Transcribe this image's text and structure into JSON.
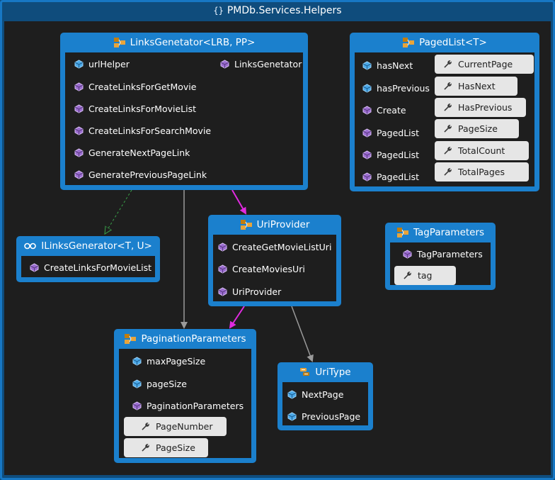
{
  "namespace": {
    "title": "PMDb.Services.Helpers",
    "icon": "namespace-icon"
  },
  "colors": {
    "frame": "#1777c4",
    "box": "#1b80cd",
    "canvas": "#1e1e1e",
    "association": "#e02ae0",
    "dependency": "#9a9a9a",
    "inheritance": "#3aa34a"
  },
  "links_generator": {
    "title": "LinksGenetator<LRB, PP>",
    "members": [
      "urlHelper",
      "CreateLinksForGetMovie",
      "CreateLinksForMovieList",
      "CreateLinksForSearchMovie",
      "GenerateNextPageLink",
      "GeneratePreviousPageLink"
    ],
    "constructor": "LinksGenetator"
  },
  "paged_list": {
    "title": "PagedList<T>",
    "members": [
      "hasNext",
      "hasPrevious",
      "Create",
      "PagedList",
      "PagedList",
      "PagedList"
    ],
    "properties": [
      "CurrentPage",
      "HasNext",
      "HasPrevious",
      "PageSize",
      "TotalCount",
      "TotalPages"
    ]
  },
  "ilinks_generator": {
    "title": "ILinksGenerator<T, U>",
    "members": [
      "CreateLinksForMovieList"
    ]
  },
  "uri_provider": {
    "title": "UriProvider",
    "members": [
      "CreateGetMovieListUri",
      "CreateMoviesUri",
      "UriProvider"
    ]
  },
  "tag_parameters": {
    "title": "TagParameters",
    "members": [
      "TagParameters"
    ],
    "properties": [
      "tag"
    ]
  },
  "pagination_parameters": {
    "title": "PaginationParameters",
    "members": [
      "maxPageSize",
      "pageSize",
      "PaginationParameters"
    ],
    "properties": [
      "PageNumber",
      "PageSize"
    ]
  },
  "uri_type": {
    "title": "UriType",
    "members": [
      "NextPage",
      "PreviousPage"
    ]
  }
}
